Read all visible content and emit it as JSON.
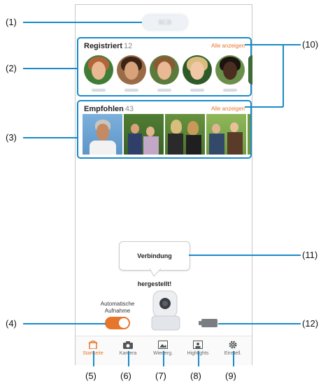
{
  "callouts": {
    "c1": "(1)",
    "c2": "(2)",
    "c3": "(3)",
    "c4": "(4)",
    "c5": "(5)",
    "c6": "(6)",
    "c7": "(7)",
    "c8": "(8)",
    "c9": "(9)",
    "c10": "(10)",
    "c11": "(11)",
    "c12": "(12)"
  },
  "header": {
    "device_name": "BCB"
  },
  "registered": {
    "title": "Registriert",
    "count": "12",
    "link": "Alle anzeigen"
  },
  "recommended": {
    "title": "Empfohlen",
    "count": "43",
    "link": "Alle anzeigen"
  },
  "bubble": {
    "text": "Verbindung hergestellt!"
  },
  "auto_capture": {
    "label_line1": "Automatische",
    "label_line2": "Aufnahme",
    "enabled": true
  },
  "tabs": [
    {
      "label": "Startseite",
      "icon": "home-icon",
      "active": true
    },
    {
      "label": "Kamera",
      "icon": "camera-icon",
      "active": false
    },
    {
      "label": "Wiederg.",
      "icon": "image-icon",
      "active": false
    },
    {
      "label": "Highlights",
      "icon": "highlights-icon",
      "active": false
    },
    {
      "label": "Einstell.",
      "icon": "gear-icon",
      "active": false
    }
  ],
  "colors": {
    "accent": "#e8752c",
    "callout_line": "#1a8ac8",
    "frame": "#1a8ac8"
  }
}
